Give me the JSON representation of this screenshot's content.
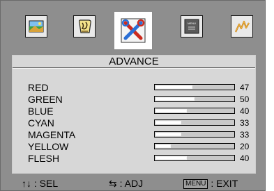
{
  "menu": {
    "icons": [
      {
        "name": "picture-icon",
        "selected": false
      },
      {
        "name": "image-adjust-icon",
        "selected": false
      },
      {
        "name": "tools-icon",
        "selected": true
      },
      {
        "name": "menu-setup-icon",
        "selected": false,
        "label": "MENU"
      },
      {
        "name": "signal-icon",
        "selected": false
      }
    ]
  },
  "panel": {
    "title": "ADVANCE",
    "max_value": 100,
    "rows": [
      {
        "label": "RED",
        "value": 47
      },
      {
        "label": "GREEN",
        "value": 50
      },
      {
        "label": "BLUE",
        "value": 40
      },
      {
        "label": "CYAN",
        "value": 33
      },
      {
        "label": "MAGENTA",
        "value": 33
      },
      {
        "label": "YELLOW",
        "value": 20
      },
      {
        "label": "FLESH",
        "value": 40
      }
    ]
  },
  "footer": {
    "sel_key": "↑↓",
    "sel_label": ": SEL",
    "adj_key": "⇆",
    "adj_label": ": ADJ",
    "menu_key": "MENU",
    "exit_label": ": EXIT"
  }
}
